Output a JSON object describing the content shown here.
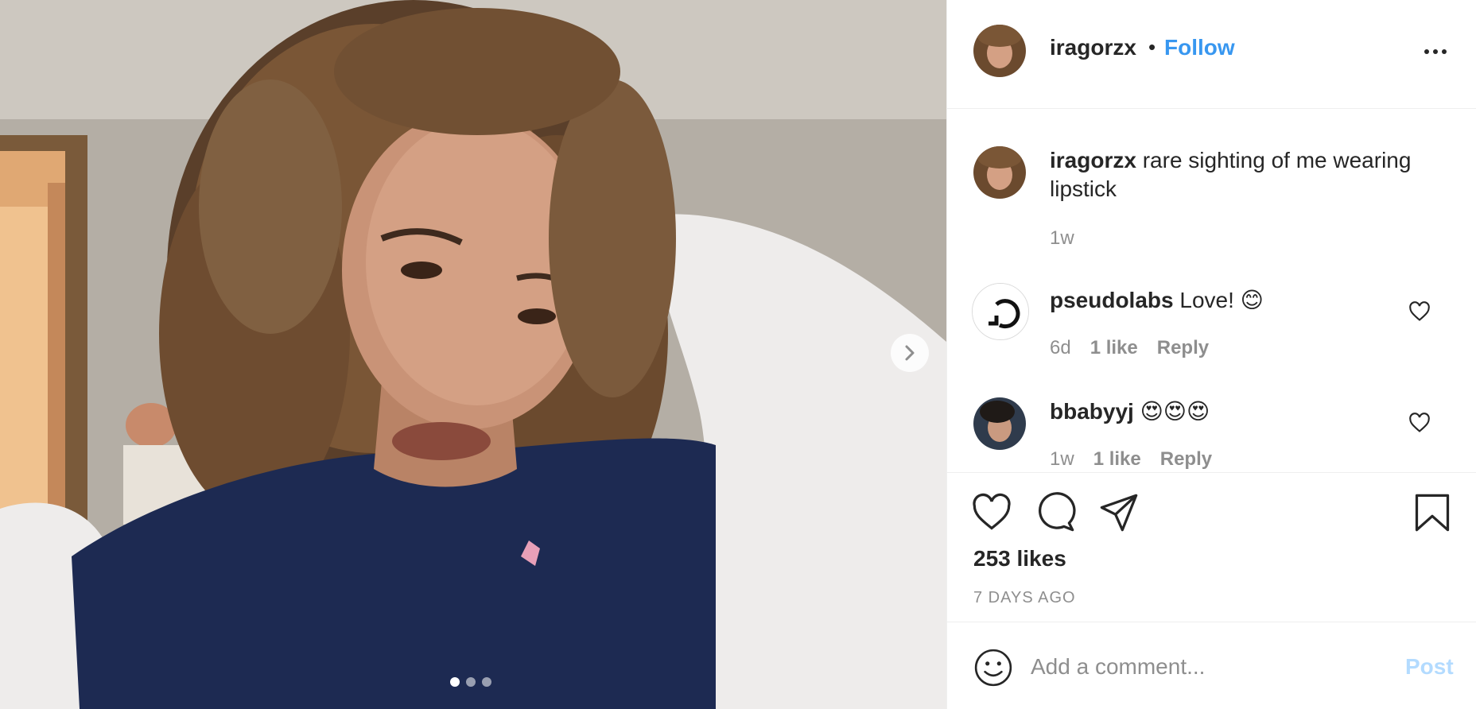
{
  "post": {
    "username": "iragorzx",
    "separator": "•",
    "follow_label": "Follow",
    "caption_username": "iragorzx",
    "caption_text": "rare sighting of me wearing lipstick",
    "caption_time": "1w",
    "likes_label": "253 likes",
    "time_label": "7 DAYS AGO",
    "carousel_dots": 3,
    "carousel_active_index": 0
  },
  "comments": [
    {
      "username": "pseudolabs",
      "text": "Love! 😊",
      "time": "6d",
      "likes": "1 like",
      "reply": "Reply"
    },
    {
      "username": "bbabyyj",
      "text": "😍😍😍",
      "time": "1w",
      "likes": "1 like",
      "reply": "Reply"
    }
  ],
  "add_comment": {
    "placeholder": "Add a comment...",
    "post_label": "Post"
  },
  "colors": {
    "link_blue": "#3897f0",
    "post_disabled": "#b3dbff",
    "muted_text": "#8e8e8e",
    "divider": "#efefef"
  },
  "icons": {
    "more": "more-horizontal-icon",
    "like": "heart-icon",
    "comment": "comment-icon",
    "share": "paper-plane-icon",
    "save": "bookmark-icon",
    "emoji": "smiley-icon",
    "next": "chevron-right-icon"
  }
}
